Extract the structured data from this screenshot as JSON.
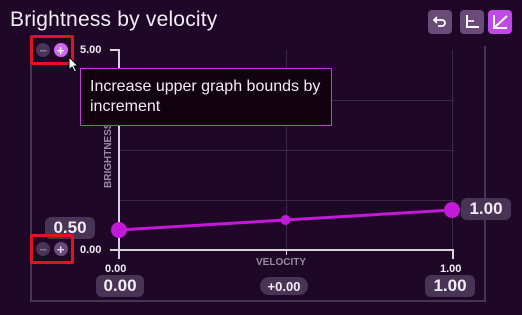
{
  "title": "Brightness by velocity",
  "toolbar": {
    "reset_icon": "reset-icon",
    "axes_icon": "axes-icon",
    "curve_icon": "linear-curve-icon",
    "accent": "#c048e6"
  },
  "graph": {
    "y_axis_label": "BRIGHTNESS",
    "x_axis_label": "VELOCITY",
    "y_max": "5.00",
    "y_min": "0.00",
    "x_min": "0.00",
    "x_max": "1.00",
    "start_value": "0.50",
    "end_value": "1.00",
    "x_start_value": "0.00",
    "x_offset_value": "+0.00",
    "x_end_value": "1.00",
    "curve_color": "#c21ad8",
    "points": [
      {
        "velocity": 0.0,
        "brightness": 0.5
      },
      {
        "velocity": 0.5,
        "brightness": 0.75
      },
      {
        "velocity": 1.0,
        "brightness": 1.0
      }
    ],
    "y_range": [
      0,
      5
    ],
    "x_range": [
      0,
      1
    ]
  },
  "tooltip": {
    "text": "Increase upper graph bounds by increment"
  }
}
